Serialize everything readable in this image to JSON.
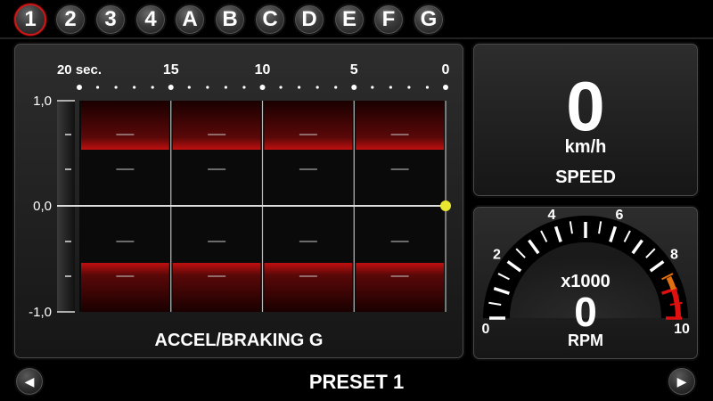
{
  "tabs": [
    {
      "label": "1",
      "active": true
    },
    {
      "label": "2",
      "active": false
    },
    {
      "label": "3",
      "active": false
    },
    {
      "label": "4",
      "active": false
    },
    {
      "label": "A",
      "active": false
    },
    {
      "label": "B",
      "active": false
    },
    {
      "label": "C",
      "active": false
    },
    {
      "label": "D",
      "active": false
    },
    {
      "label": "E",
      "active": false
    },
    {
      "label": "F",
      "active": false
    },
    {
      "label": "G",
      "active": false
    }
  ],
  "accel": {
    "title": "ACCEL/BRAKING G",
    "time_labels": [
      "20 sec.",
      "15",
      "10",
      "5",
      "0"
    ],
    "y_labels": [
      "1,0",
      "0,0",
      "-1,0"
    ],
    "current_value": 0.0,
    "colors": {
      "band": "#c01010",
      "marker": "#e8e830",
      "line": "#dddddd"
    }
  },
  "speed": {
    "value": "0",
    "unit": "km/h",
    "label": "SPEED"
  },
  "rpm": {
    "multiplier": "x1000",
    "value": "0",
    "label": "RPM",
    "scale_labels": [
      "0",
      "2",
      "4",
      "6",
      "8",
      "10"
    ],
    "colors": {
      "warn": "#e07010",
      "red": "#e01010"
    }
  },
  "footer": {
    "preset": "PRESET 1",
    "prev_icon": "left-arrow-icon",
    "next_icon": "right-arrow-icon"
  }
}
